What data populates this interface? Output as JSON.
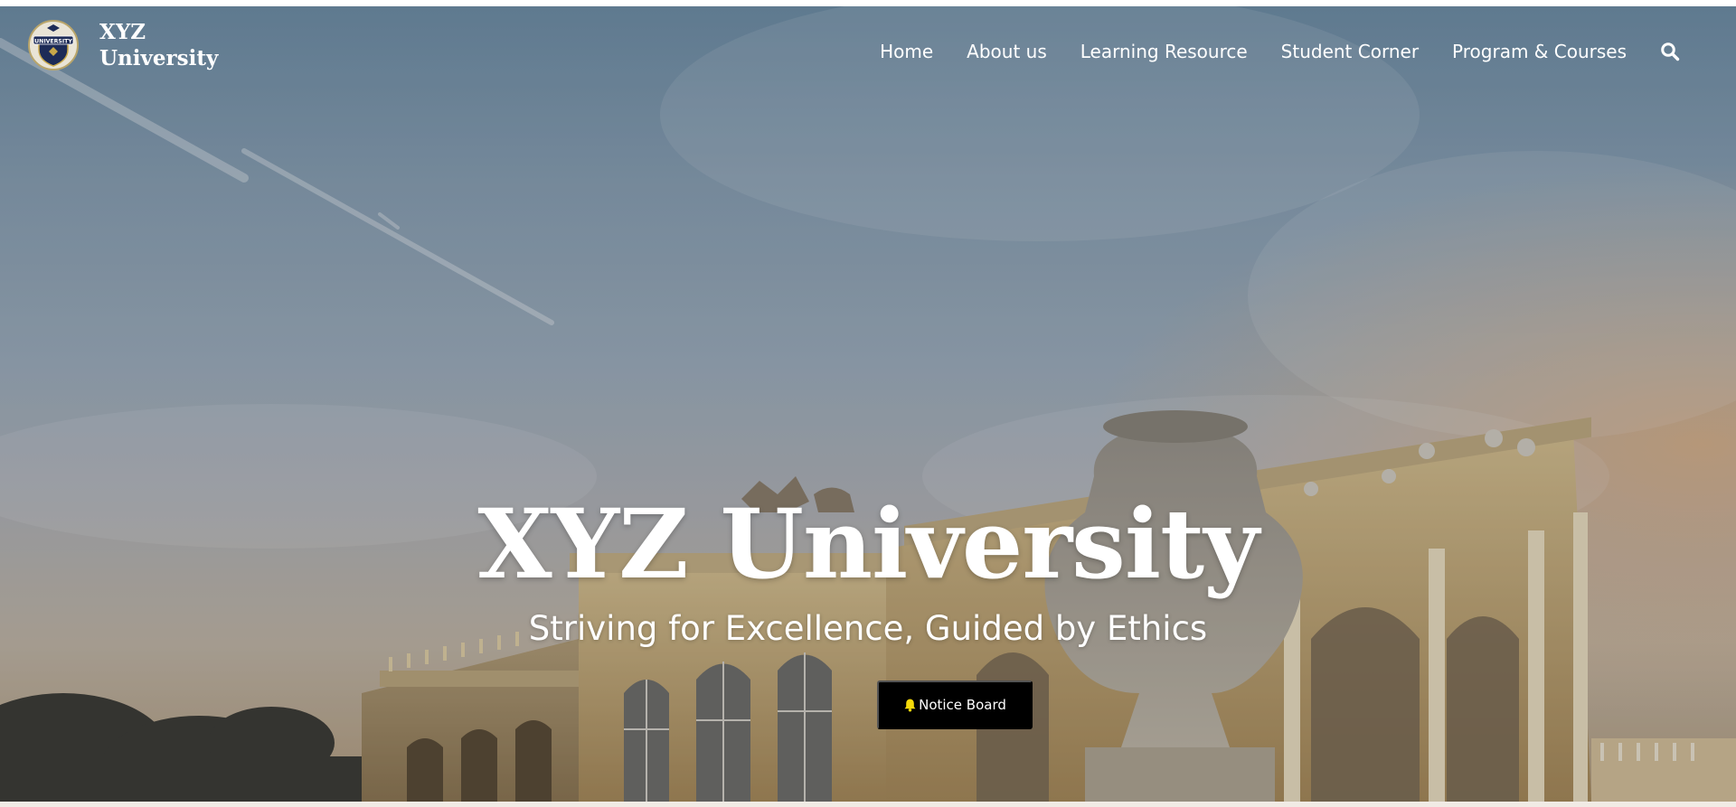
{
  "brand": {
    "logo_icon": "university-crest-icon",
    "logo_text": "UNIVERSITY",
    "name": "XYZ University"
  },
  "nav": {
    "items": [
      {
        "label": "Home"
      },
      {
        "label": "About us"
      },
      {
        "label": "Learning Resource"
      },
      {
        "label": "Student Corner"
      },
      {
        "label": "Program & Courses"
      }
    ],
    "search_icon": "search-icon"
  },
  "hero": {
    "title": "XYZ University",
    "subtitle": "Striving for Excellence, Guided by Ethics",
    "cta": {
      "label": "Notice Board",
      "icon": "bell-icon",
      "icon_color": "#f5d90a"
    },
    "background": "campus-building-photo"
  },
  "colors": {
    "nav_text": "#ffffff",
    "button_bg": "#000000",
    "button_text": "#ffffff"
  }
}
